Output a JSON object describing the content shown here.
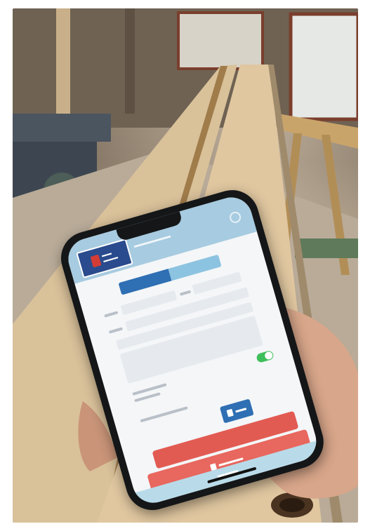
{
  "colors": {
    "app_header": "#a7cbe0",
    "logo_blue": "#2a4b8d",
    "primary_blue": "#2f6fb3",
    "light_blue": "#8cc3e0",
    "toggle_green": "#3fbf5a",
    "action_red": "#e25b52",
    "footer_blue": "#b9dbe9"
  },
  "phone_screen": {
    "toggle_on": true,
    "icons": [
      "logo-icon",
      "settings-icon",
      "save-icon",
      "delete-icon"
    ]
  }
}
